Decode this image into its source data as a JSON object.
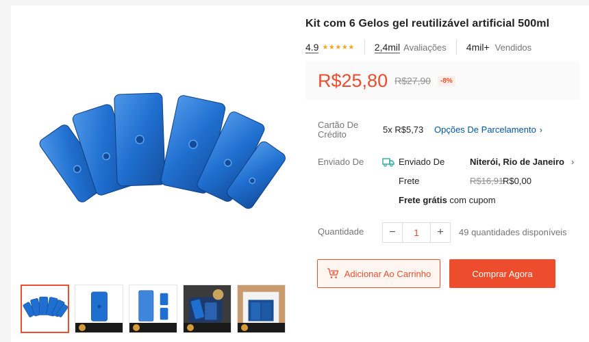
{
  "product": {
    "title": "Kit com 6 Gelos gel reutilizável artificial 500ml",
    "rating": "4.9",
    "rating_stars": 5,
    "reviews_count": "2,4mil",
    "reviews_label": "Avaliações",
    "sold_count": "4mil+",
    "sold_label": "Vendidos"
  },
  "price": {
    "current": "R$25,80",
    "original": "R$27,90",
    "discount": "-8%"
  },
  "credit": {
    "label": "Cartão De Crédito",
    "installments": "5x R$5,73",
    "link": "Opções De Parcelamento"
  },
  "shipping": {
    "label": "Enviado De",
    "from_label": "Enviado De",
    "destination": "Niterói, Rio de Janeiro",
    "freight_label": "Frete",
    "freight_original": "R$16,91",
    "freight_current": "R$0,00",
    "free_bold": "Frete grátis",
    "free_rest": " com cupom"
  },
  "quantity": {
    "label": "Quantidade",
    "value": "1",
    "minus": "−",
    "plus": "+",
    "available": "49 quantidades disponíveis"
  },
  "actions": {
    "add_to_cart": "Adicionar Ao Carrinho",
    "buy_now": "Comprar Agora"
  },
  "colors": {
    "accent": "#ee4d2d",
    "link": "#0055aa",
    "product_blue": "#1f6fd0"
  }
}
